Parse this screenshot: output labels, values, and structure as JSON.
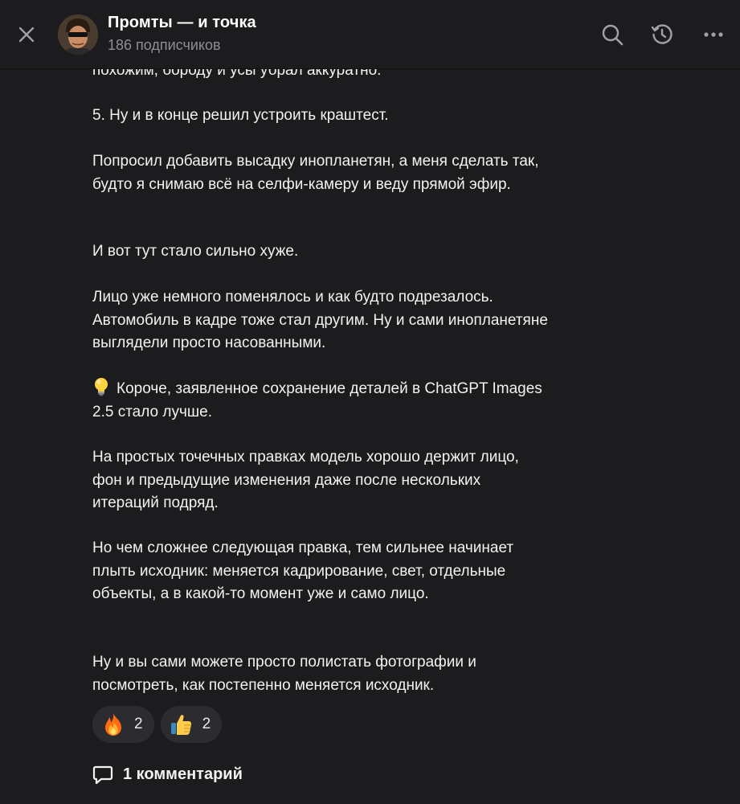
{
  "header": {
    "channel_title": "Промты — и точка",
    "subscribers": "186 подписчиков",
    "icons": [
      "close-icon",
      "search-icon",
      "history-icon",
      "more-icon"
    ]
  },
  "post": {
    "partial_top": "похожим, бороду и усы убрал аккуратно.",
    "p1": "5. Ну и в конце решил устроить краштест.",
    "p2": "Попросил добавить высадку инопланетян, а меня сделать так, будто я снимаю всё на селфи-камеру и веду прямой эфир.",
    "p3": "И вот тут стало сильно хуже.",
    "p4": "Лицо уже немного поменялось и как будто подрезалось. Автомобиль в кадре тоже стал другим. Ну и сами инопланетяне выглядели просто насованными.",
    "p5": "Короче, заявленное сохранение деталей в ChatGPT Images 2.5 стало лучше.",
    "p6": "На простых точечных правках модель хорошо держит лицо, фон и предыдущие изменения даже после нескольких итераций подряд.",
    "p7": "Но чем сложнее следующая правка, тем сильнее начинает плыть исходник: меняется кадрирование, свет, отдельные объекты, а в какой-то момент уже и само лицо.",
    "p8": "Ну и вы сами можете просто полистать фотографии и посмотреть, как постепенно меняется исходник."
  },
  "reactions": [
    {
      "emoji": "fire-icon",
      "count": "2"
    },
    {
      "emoji": "thumbs-up-icon",
      "count": "2"
    }
  ],
  "comments": {
    "label": "1 комментарий"
  },
  "colors": {
    "background": "#1c1c1e",
    "text": "#f2f2f2",
    "muted": "#8e8e93",
    "pill": "#2c2c30"
  }
}
